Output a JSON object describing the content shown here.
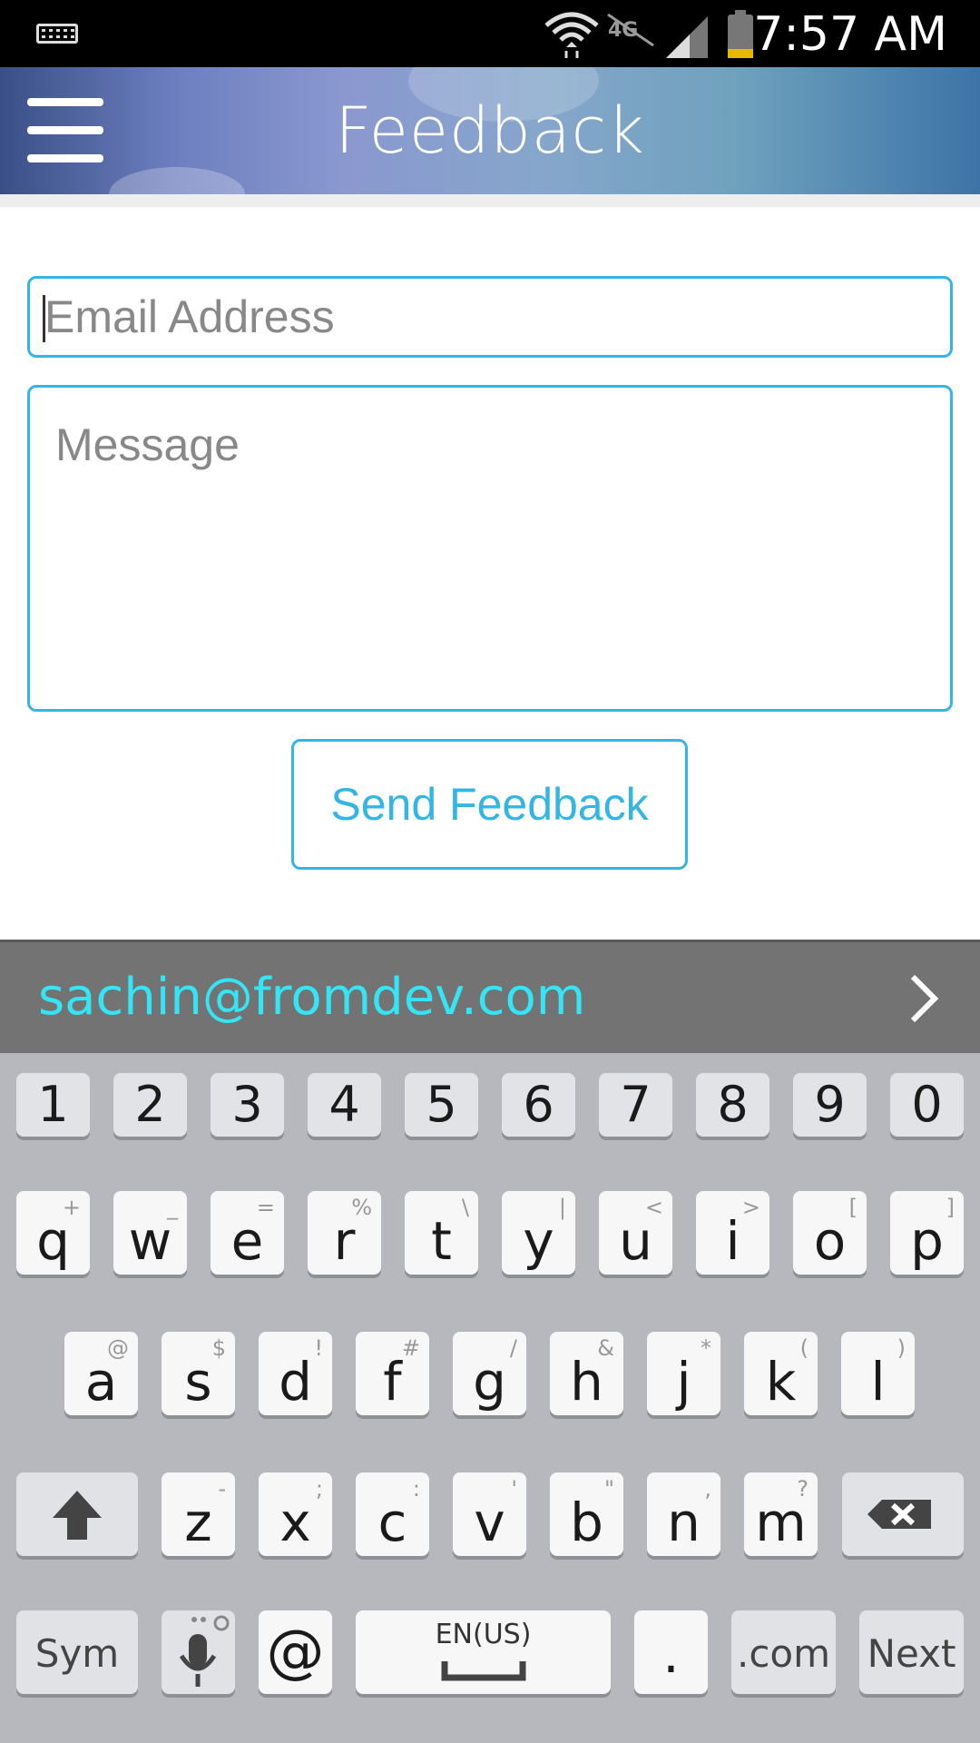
{
  "status_bar": {
    "time": "7:57 AM",
    "icons": [
      "keyboard-icon",
      "wifi-icon",
      "lte-off-icon",
      "signal-icon",
      "battery-icon"
    ]
  },
  "header": {
    "title": "Feedback",
    "menu_icon": "menu-icon"
  },
  "form": {
    "email_placeholder": "Email Address",
    "message_placeholder": "Message",
    "send_label": "Send Feedback"
  },
  "suggestion": {
    "text": "sachin@fromdev.com",
    "chevron_icon": "chevron-right-icon"
  },
  "keyboard": {
    "number_row": [
      "1",
      "2",
      "3",
      "4",
      "5",
      "6",
      "7",
      "8",
      "9",
      "0"
    ],
    "row1": [
      {
        "key": "q",
        "alt": "+"
      },
      {
        "key": "w",
        "alt": "_"
      },
      {
        "key": "e",
        "alt": "="
      },
      {
        "key": "r",
        "alt": "%"
      },
      {
        "key": "t",
        "alt": "\\"
      },
      {
        "key": "y",
        "alt": "|"
      },
      {
        "key": "u",
        "alt": "<"
      },
      {
        "key": "i",
        "alt": ">"
      },
      {
        "key": "o",
        "alt": "["
      },
      {
        "key": "p",
        "alt": "]"
      }
    ],
    "row2": [
      {
        "key": "a",
        "alt": "@"
      },
      {
        "key": "s",
        "alt": "$"
      },
      {
        "key": "d",
        "alt": "!"
      },
      {
        "key": "f",
        "alt": "#"
      },
      {
        "key": "g",
        "alt": "/"
      },
      {
        "key": "h",
        "alt": "&"
      },
      {
        "key": "j",
        "alt": "*"
      },
      {
        "key": "k",
        "alt": "("
      },
      {
        "key": "l",
        "alt": ")"
      }
    ],
    "row3": [
      {
        "key": "z",
        "alt": "-"
      },
      {
        "key": "x",
        "alt": ";"
      },
      {
        "key": "c",
        "alt": ":"
      },
      {
        "key": "v",
        "alt": "'"
      },
      {
        "key": "b",
        "alt": "\""
      },
      {
        "key": "n",
        "alt": ","
      },
      {
        "key": "m",
        "alt": "?"
      }
    ],
    "sym_label": "Sym",
    "at_label": "@",
    "space_label": "EN(US)",
    "period_label": ".",
    "dotcom_label": ".com",
    "next_label": "Next",
    "shift_icon": "shift-icon",
    "backspace_icon": "backspace-icon",
    "mic_icon": "microphone-icon"
  }
}
